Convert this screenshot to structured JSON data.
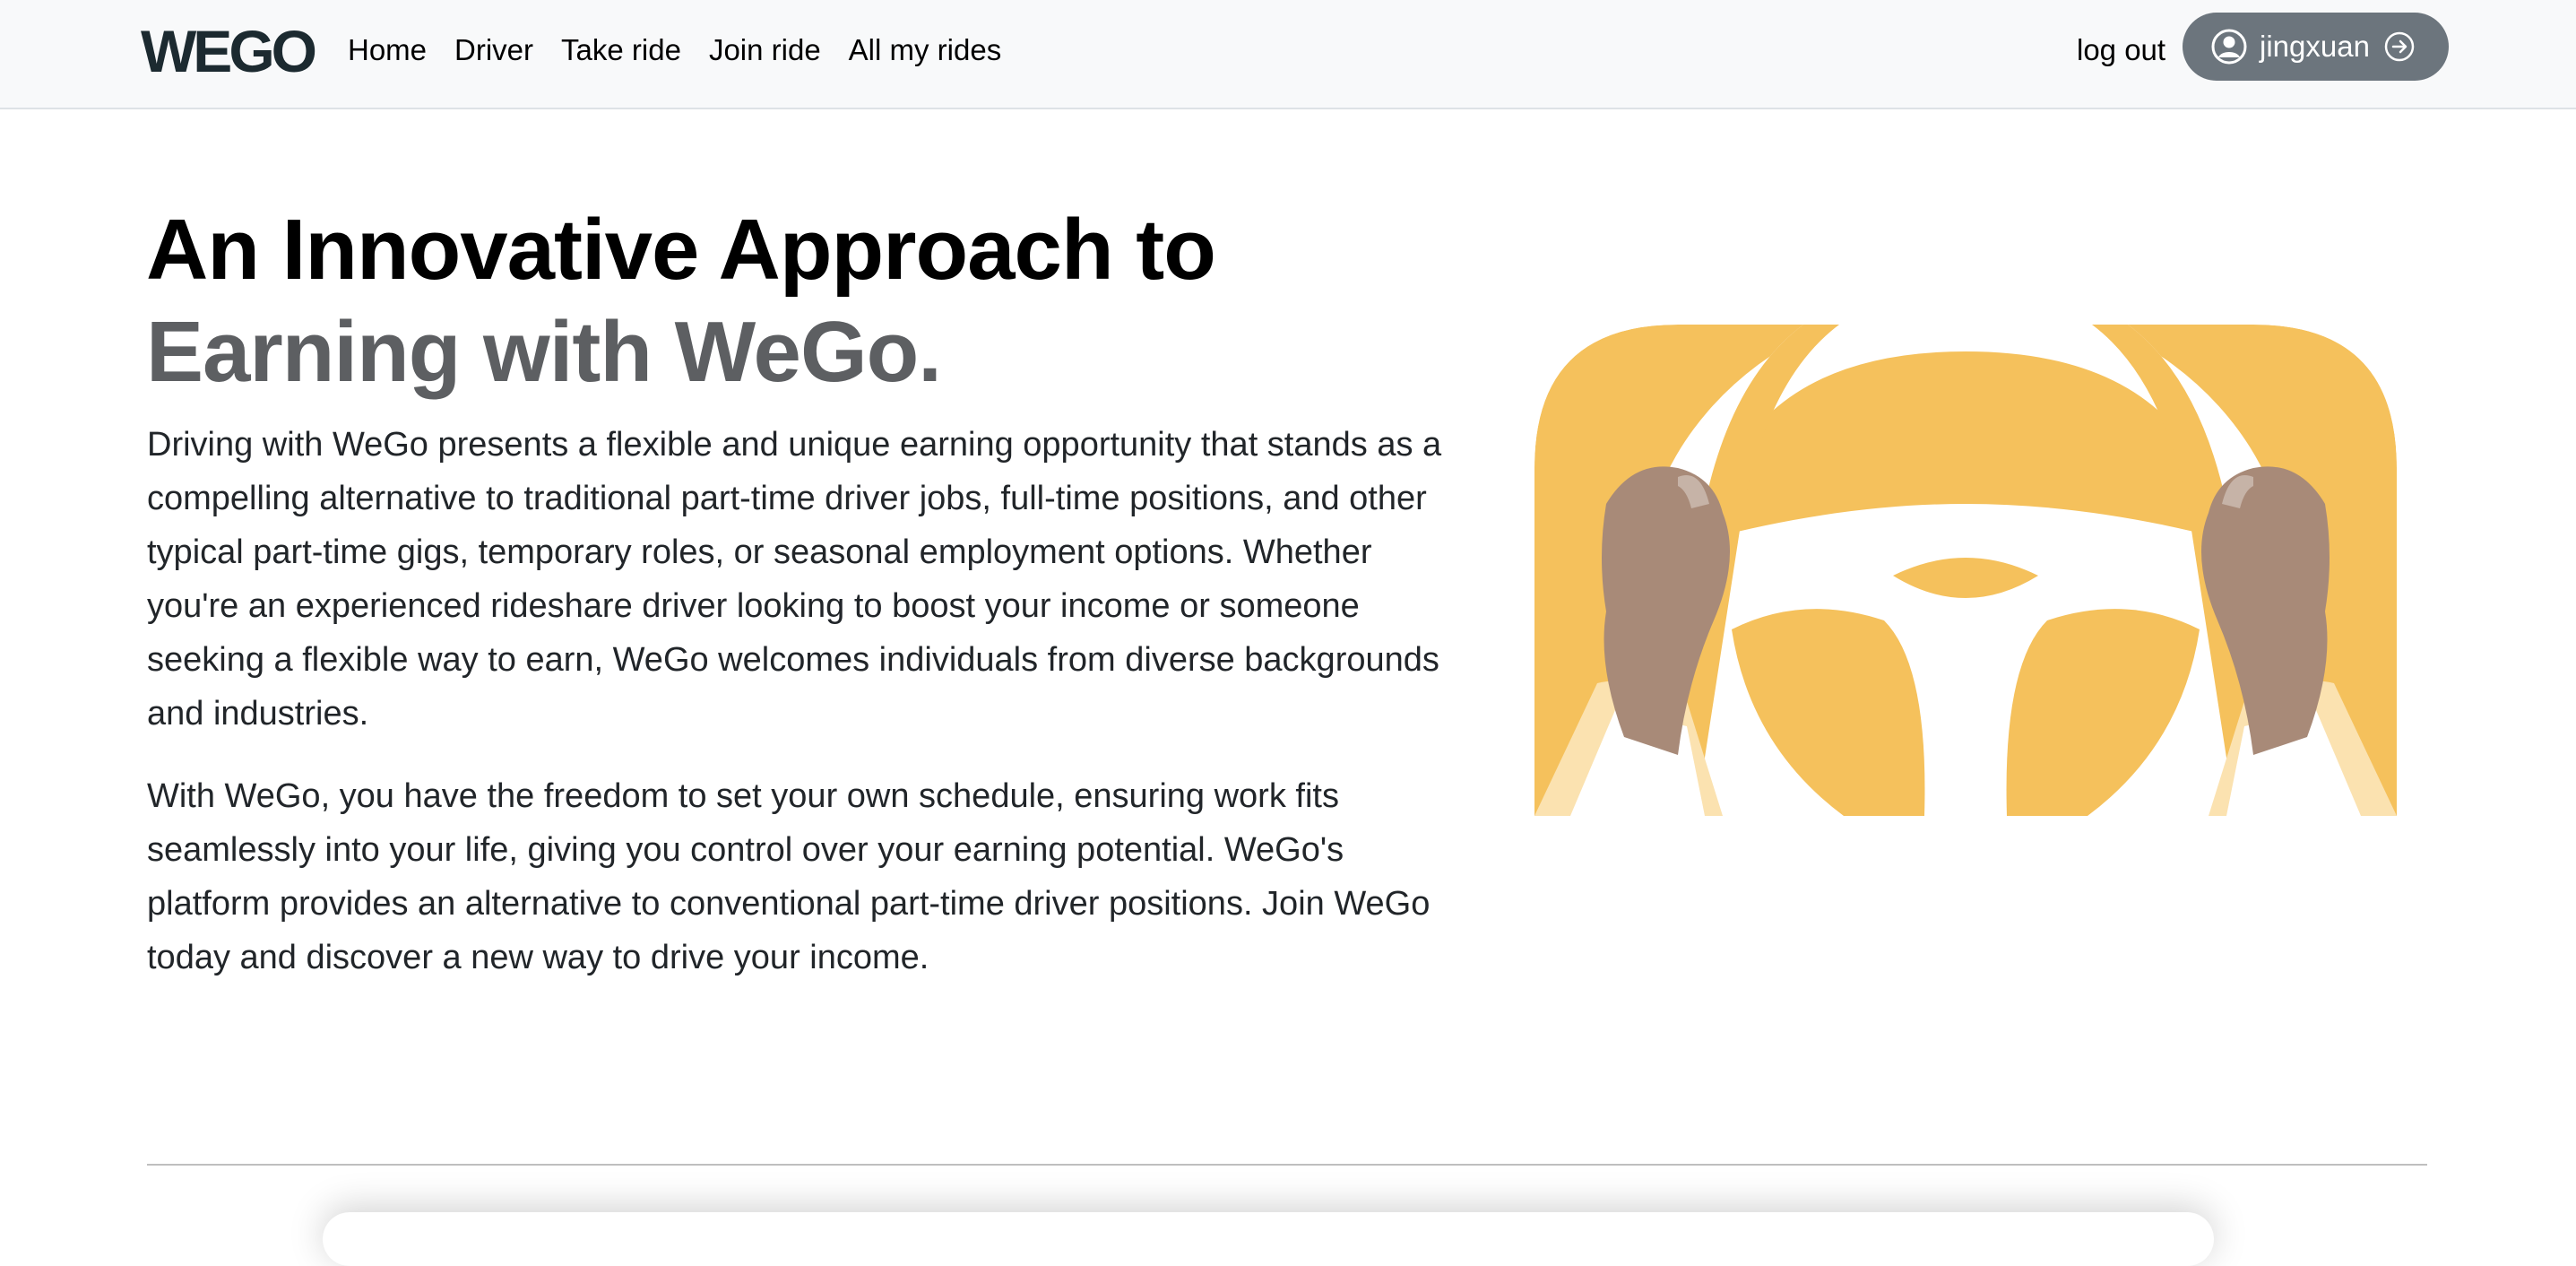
{
  "brand": {
    "logo_text": "WEGO",
    "color": "#1c2a30"
  },
  "nav": {
    "links": [
      {
        "label": "Home"
      },
      {
        "label": "Driver"
      },
      {
        "label": "Take ride"
      },
      {
        "label": "Join ride"
      },
      {
        "label": "All my rides"
      }
    ],
    "logout_label": "log out",
    "user": {
      "username": "jingxuan",
      "avatar_icon": "person-circle-icon",
      "action_icon": "arrow-right-circle-icon",
      "button_color": "#6c757d"
    }
  },
  "hero": {
    "title_line1": "An Innovative Approach to",
    "title_line2": "Earning with WeGo.",
    "paragraph1": "Driving with WeGo presents a flexible and unique earning opportunity that stands as a compelling alternative to traditional part-time driver jobs, full-time positions, and other typical part-time gigs, temporary roles, or seasonal employment options. Whether you're an experienced rideshare driver looking to boost your income or someone seeking a flexible way to earn, WeGo welcomes individuals from diverse backgrounds and industries.",
    "paragraph2": "With WeGo, you have the freedom to set your own schedule, ensuring work fits seamlessly into your life, giving you control over your earning potential. WeGo's platform provides an alternative to conventional part-time driver positions. Join WeGo today and discover a new way to drive your income.",
    "illustration": "steering-wheel-hands-illustration",
    "accent_color": "#f5c15c"
  }
}
